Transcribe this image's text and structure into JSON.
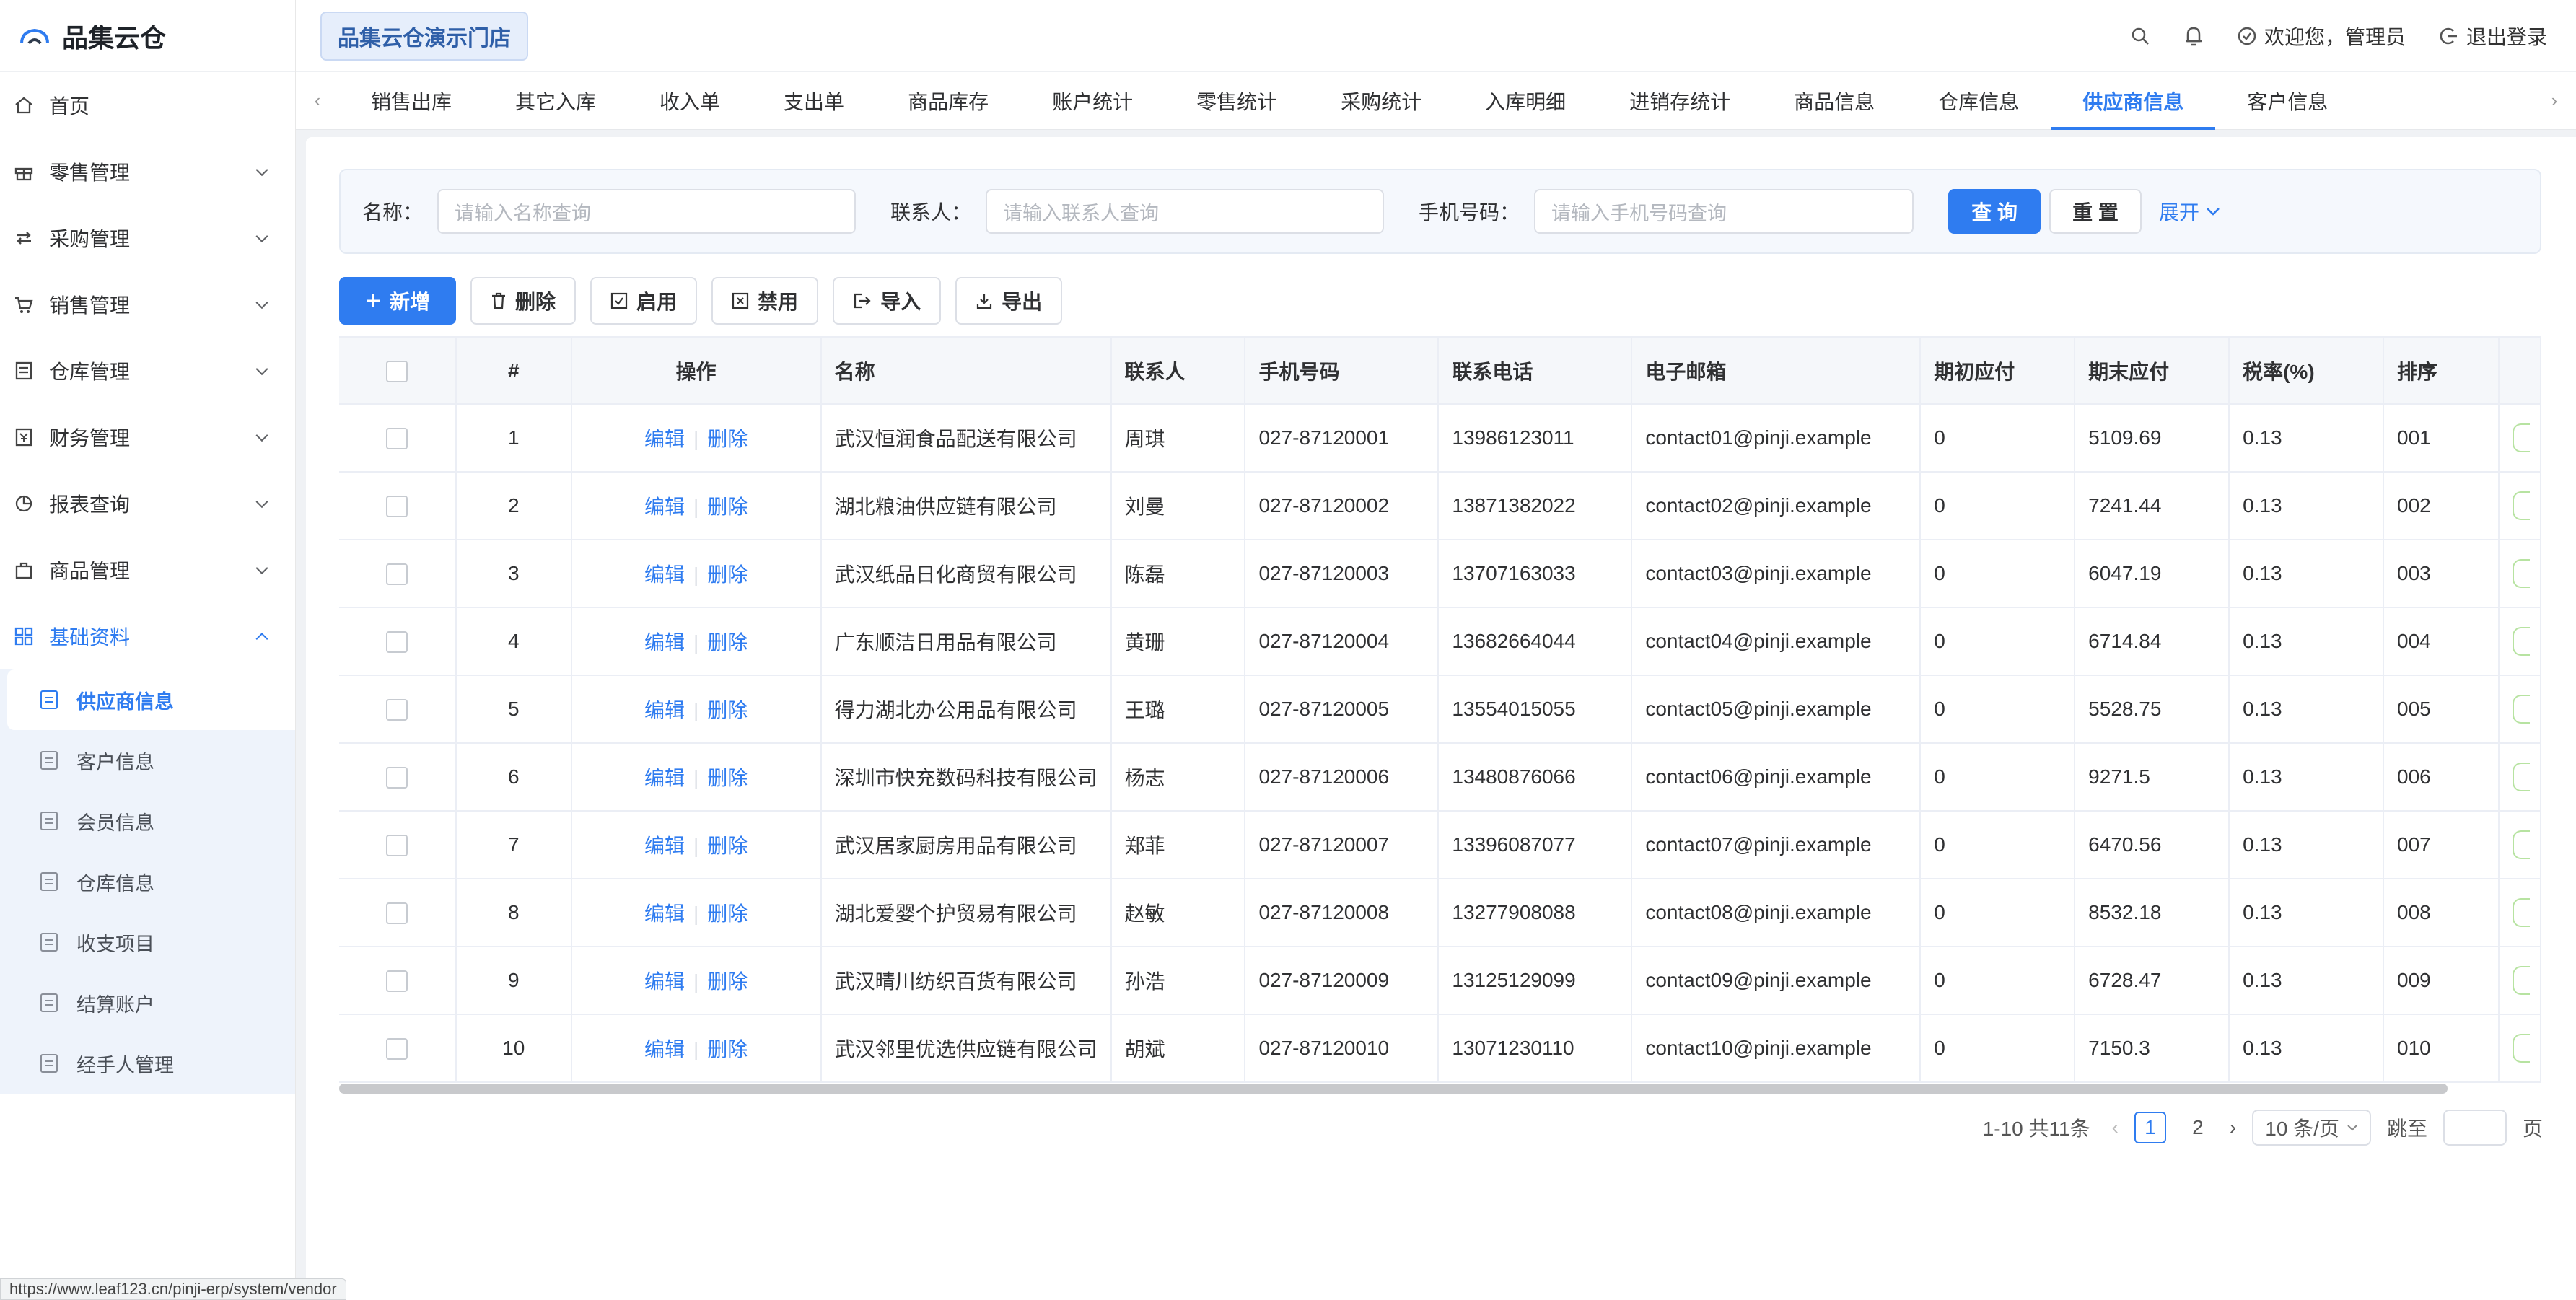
{
  "app": {
    "name": "品集云仓"
  },
  "sidebar": {
    "items": [
      {
        "label": "首页",
        "icon": "home-icon"
      },
      {
        "label": "零售管理",
        "icon": "gift-icon"
      },
      {
        "label": "采购管理",
        "icon": "transfer-icon"
      },
      {
        "label": "销售管理",
        "icon": "cart-icon"
      },
      {
        "label": "仓库管理",
        "icon": "warehouse-icon"
      },
      {
        "label": "财务管理",
        "icon": "finance-icon"
      },
      {
        "label": "报表查询",
        "icon": "pie-chart-icon"
      },
      {
        "label": "商品管理",
        "icon": "goods-icon"
      },
      {
        "label": "基础资料",
        "icon": "grid-icon"
      }
    ],
    "subitems": [
      {
        "label": "供应商信息"
      },
      {
        "label": "客户信息"
      },
      {
        "label": "会员信息"
      },
      {
        "label": "仓库信息"
      },
      {
        "label": "收支项目"
      },
      {
        "label": "结算账户"
      },
      {
        "label": "经手人管理"
      }
    ]
  },
  "header": {
    "store": "品集云仓演示门店",
    "welcome": "欢迎您，管理员",
    "logout": "退出登录"
  },
  "tabs": [
    "销售出库",
    "其它入库",
    "收入单",
    "支出单",
    "商品库存",
    "账户统计",
    "零售统计",
    "采购统计",
    "入库明细",
    "进销存统计",
    "商品信息",
    "仓库信息",
    "供应商信息",
    "客户信息"
  ],
  "filter": {
    "name_label": "名称：",
    "name_placeholder": "请输入名称查询",
    "contact_label": "联系人：",
    "contact_placeholder": "请输入联系人查询",
    "phone_label": "手机号码：",
    "phone_placeholder": "请输入手机号码查询",
    "query": "查 询",
    "reset": "重 置",
    "expand": "展开"
  },
  "toolbar": {
    "add": "新增",
    "delete": "删除",
    "enable": "启用",
    "disable": "禁用",
    "import": "导入",
    "export": "导出"
  },
  "table": {
    "headers": [
      "#",
      "操作",
      "名称",
      "联系人",
      "手机号码",
      "联系电话",
      "电子邮箱",
      "期初应付",
      "期末应付",
      "税率(%)",
      "排序"
    ],
    "edit": "编辑",
    "delete": "删除",
    "rows": [
      {
        "no": "1",
        "name": "武汉恒润食品配送有限公司",
        "contact": "周琪",
        "mobile": "027-87120001",
        "phone": "13986123011",
        "email": "contact01@pinji.example",
        "begin": "0",
        "end": "5109.69",
        "tax": "0.13",
        "sort": "001"
      },
      {
        "no": "2",
        "name": "湖北粮油供应链有限公司",
        "contact": "刘曼",
        "mobile": "027-87120002",
        "phone": "13871382022",
        "email": "contact02@pinji.example",
        "begin": "0",
        "end": "7241.44",
        "tax": "0.13",
        "sort": "002"
      },
      {
        "no": "3",
        "name": "武汉纸品日化商贸有限公司",
        "contact": "陈磊",
        "mobile": "027-87120003",
        "phone": "13707163033",
        "email": "contact03@pinji.example",
        "begin": "0",
        "end": "6047.19",
        "tax": "0.13",
        "sort": "003"
      },
      {
        "no": "4",
        "name": "广东顺洁日用品有限公司",
        "contact": "黄珊",
        "mobile": "027-87120004",
        "phone": "13682664044",
        "email": "contact04@pinji.example",
        "begin": "0",
        "end": "6714.84",
        "tax": "0.13",
        "sort": "004"
      },
      {
        "no": "5",
        "name": "得力湖北办公用品有限公司",
        "contact": "王璐",
        "mobile": "027-87120005",
        "phone": "13554015055",
        "email": "contact05@pinji.example",
        "begin": "0",
        "end": "5528.75",
        "tax": "0.13",
        "sort": "005"
      },
      {
        "no": "6",
        "name": "深圳市快充数码科技有限公司",
        "contact": "杨志",
        "mobile": "027-87120006",
        "phone": "13480876066",
        "email": "contact06@pinji.example",
        "begin": "0",
        "end": "9271.5",
        "tax": "0.13",
        "sort": "006"
      },
      {
        "no": "7",
        "name": "武汉居家厨房用品有限公司",
        "contact": "郑菲",
        "mobile": "027-87120007",
        "phone": "13396087077",
        "email": "contact07@pinji.example",
        "begin": "0",
        "end": "6470.56",
        "tax": "0.13",
        "sort": "007"
      },
      {
        "no": "8",
        "name": "湖北爱婴个护贸易有限公司",
        "contact": "赵敏",
        "mobile": "027-87120008",
        "phone": "13277908088",
        "email": "contact08@pinji.example",
        "begin": "0",
        "end": "8532.18",
        "tax": "0.13",
        "sort": "008"
      },
      {
        "no": "9",
        "name": "武汉晴川纺织百货有限公司",
        "contact": "孙浩",
        "mobile": "027-87120009",
        "phone": "13125129099",
        "email": "contact09@pinji.example",
        "begin": "0",
        "end": "6728.47",
        "tax": "0.13",
        "sort": "009"
      },
      {
        "no": "10",
        "name": "武汉邻里优选供应链有限公司",
        "contact": "胡斌",
        "mobile": "027-87120010",
        "phone": "13071230110",
        "email": "contact10@pinji.example",
        "begin": "0",
        "end": "7150.3",
        "tax": "0.13",
        "sort": "010"
      }
    ]
  },
  "pager": {
    "summary": "1-10 共11条",
    "pages": [
      "1",
      "2"
    ],
    "size": "10 条/页",
    "jump_label": "跳至",
    "page_unit": "页"
  },
  "statusbar": "https://www.leaf123.cn/pinji-erp/system/vendor",
  "colors": {
    "primary": "#2f7cf0",
    "status_green": "#b7e3a1"
  }
}
